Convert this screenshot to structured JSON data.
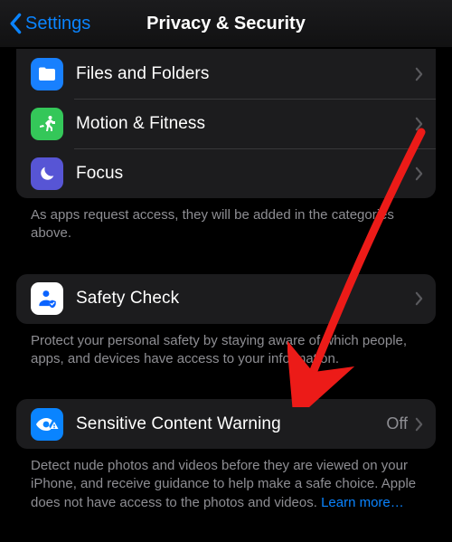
{
  "header": {
    "back_label": "Settings",
    "title": "Privacy & Security"
  },
  "group1": {
    "items": [
      {
        "label": "Files and Folders"
      },
      {
        "label": "Motion & Fitness"
      },
      {
        "label": "Focus"
      }
    ],
    "footer": "As apps request access, they will be added in the categories above."
  },
  "group2": {
    "items": [
      {
        "label": "Safety Check"
      }
    ],
    "footer": "Protect your personal safety by staying aware of which people, apps, and devices have access to your information."
  },
  "group3": {
    "items": [
      {
        "label": "Sensitive Content Warning",
        "value": "Off"
      }
    ],
    "footer": "Detect nude photos and videos before they are viewed on your iPhone, and receive guidance to help make a safe choice. Apple does not have access to the photos and videos. ",
    "learn_more": "Learn more…"
  }
}
